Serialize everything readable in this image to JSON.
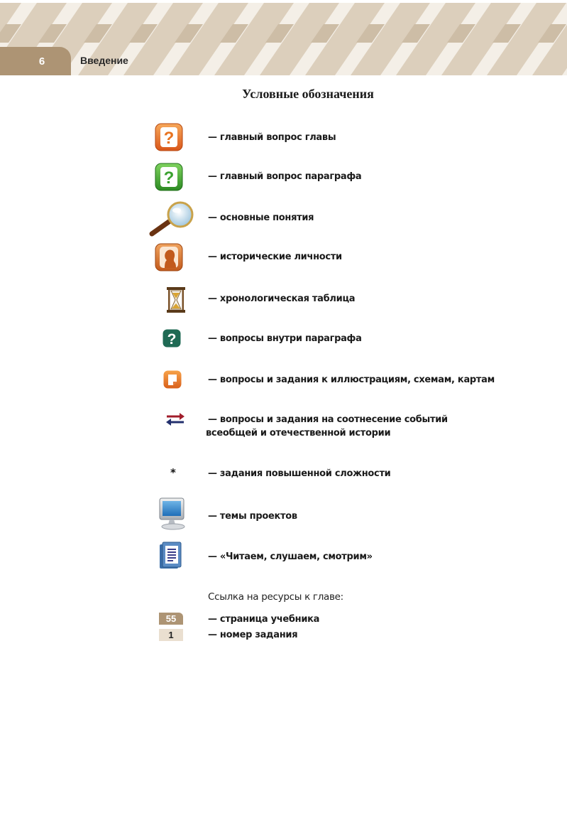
{
  "header": {
    "page_number": "6",
    "section": "Введение"
  },
  "title": "Условные обозначения",
  "legend": [
    {
      "icon": "chapter-question-icon",
      "text": "— главный вопрос главы"
    },
    {
      "icon": "paragraph-question-icon",
      "text": "— главный вопрос параграфа"
    },
    {
      "icon": "magnifier-icon",
      "text": "— основные понятия"
    },
    {
      "icon": "person-portrait-icon",
      "text": "— исторические личности"
    },
    {
      "icon": "hourglass-icon",
      "text": "— хронологическая таблица"
    },
    {
      "icon": "inner-question-icon",
      "text": "— вопросы внутри параграфа"
    },
    {
      "icon": "illustration-task-icon",
      "text": "— вопросы и задания к иллюстрациям, схемам, картам"
    },
    {
      "icon": "exchange-arrows-icon",
      "text_line1": "— вопросы и задания на соотнесение событий",
      "text_line2": "всеобщей и отечественной истории"
    },
    {
      "icon": "asterisk-icon",
      "symbol": "*",
      "text": "— задания повышенной сложности"
    },
    {
      "icon": "monitor-icon",
      "text": "— темы проектов"
    },
    {
      "icon": "reading-document-icon",
      "text": "— «Читаем, слушаем, смотрим»"
    }
  ],
  "resources": {
    "heading": "Ссылка на ресурсы к главе:",
    "page_badge": "55",
    "page_text": "— страница учебника",
    "task_badge": "1",
    "task_text": "— номер задания"
  },
  "colors": {
    "header_beige": "#d8cbb8",
    "tab_brown": "#ad9474",
    "orange": "#e8731f",
    "green": "#3aa12e",
    "teal": "#1f6a54"
  }
}
